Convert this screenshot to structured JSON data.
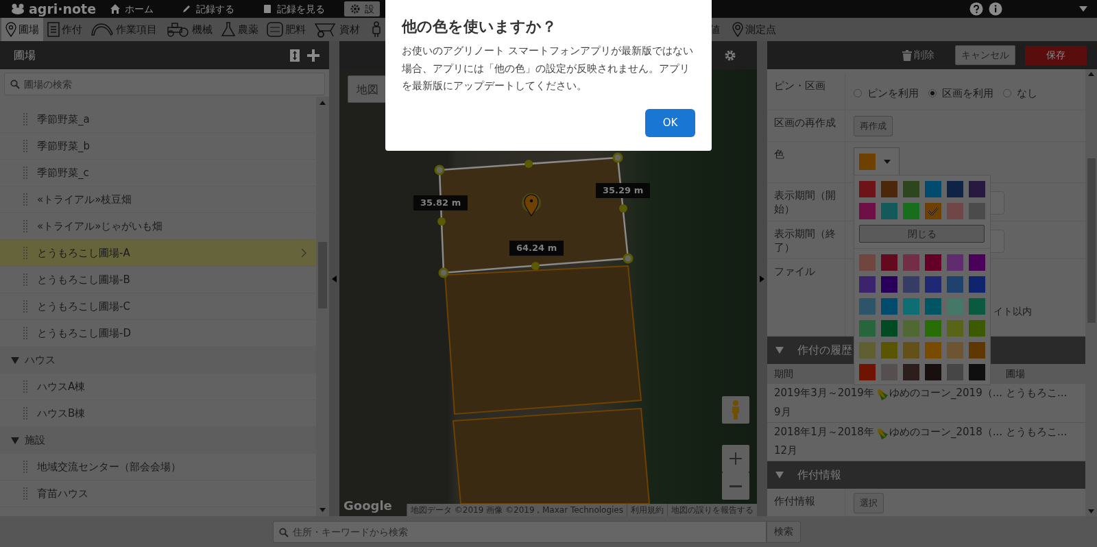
{
  "top_nav": {
    "logo": "agri·note",
    "items": [
      {
        "label": "ホーム",
        "selected": false
      },
      {
        "label": "記録する",
        "selected": false
      },
      {
        "label": "記録を見る",
        "selected": false
      },
      {
        "label": "設",
        "selected": true
      }
    ]
  },
  "toolbar": [
    {
      "label": "圃場",
      "selected": true
    },
    {
      "label": "作付",
      "selected": false
    },
    {
      "label": "作業項目",
      "selected": false
    },
    {
      "label": "機械",
      "selected": false
    },
    {
      "label": "農薬",
      "selected": false
    },
    {
      "label": "肥料",
      "selected": false
    },
    {
      "label": "資材",
      "selected": false
    },
    {
      "selected": false
    },
    {
      "label": "値",
      "selected": false
    },
    {
      "label": "測定点",
      "selected": false
    }
  ],
  "field_panel": {
    "title": "圃場",
    "search": {
      "placeholder": "圃場の検索"
    },
    "items": [
      {
        "kind": "field",
        "label": "季節野菜_a",
        "selected": false
      },
      {
        "kind": "field",
        "label": "季節野菜_b",
        "selected": false
      },
      {
        "kind": "field",
        "label": "季節野菜_c",
        "selected": false
      },
      {
        "kind": "field",
        "label": "«トライアル»枝豆畑",
        "selected": false
      },
      {
        "kind": "field",
        "label": "«トライアル»じゃがいも畑",
        "selected": false
      },
      {
        "kind": "field",
        "label": "とうもろこし圃場-A",
        "selected": true
      },
      {
        "kind": "field",
        "label": "とうもろこし圃場-B",
        "selected": false
      },
      {
        "kind": "field",
        "label": "とうもろこし圃場-C",
        "selected": false
      },
      {
        "kind": "field",
        "label": "とうもろこし圃場-D",
        "selected": false
      },
      {
        "kind": "group",
        "label": "ハウス",
        "expanded": true,
        "children": [
          {
            "kind": "field",
            "label": "ハウスA棟",
            "selected": false
          },
          {
            "kind": "field",
            "label": "ハウスB棟",
            "selected": false
          }
        ]
      },
      {
        "kind": "group",
        "label": "施設",
        "expanded": true,
        "children": [
          {
            "kind": "field",
            "label": "地域交流センター（部会会場）",
            "selected": false
          },
          {
            "kind": "field",
            "label": "育苗ハウス",
            "selected": false
          }
        ]
      }
    ]
  },
  "map": {
    "map_type_button": "地図",
    "distance_labels": [
      "35.82 m",
      "35.29 m",
      "64.24 m"
    ],
    "logo": "Google",
    "attribution": [
      "地図データ ©2019 画像 ©2019 , Maxar Technologies",
      "利用規約",
      "地図の誤りを報告する"
    ]
  },
  "address_search": {
    "placeholder": "住所・キーワードから検索",
    "button": "検索"
  },
  "detail_panel": {
    "actions": {
      "delete": "削除",
      "cancel": "キャンセル",
      "save": "保存"
    },
    "pin_area": {
      "label": "ピン・区画",
      "options": [
        {
          "label": "ピンを利用",
          "selected": false
        },
        {
          "label": "区画を利用",
          "selected": true
        },
        {
          "label": "なし",
          "selected": false
        }
      ]
    },
    "recreate": {
      "label": "区画の再作成",
      "button": "再作成"
    },
    "color": {
      "label": "色",
      "color": "#6e4100"
    },
    "display_start": {
      "label": "表示期間（開始）"
    },
    "display_end": {
      "label": "表示期間（終了）"
    },
    "file": {
      "label": "ファイル",
      "note": "イト以内"
    },
    "history": {
      "title": "作付の履歴",
      "expanded": true,
      "column_1": "期間",
      "column_3": "圃場",
      "rows": [
        {
          "period": "2019年3月～2019年9月",
          "crop": "ゆめのコーン_2019（...",
          "field": "とうもろこ..."
        },
        {
          "period": "2018年1月～2018年12月",
          "crop": "ゆめのコーン_2018（...",
          "field": "とうもろこ..."
        }
      ]
    },
    "crop_info": {
      "title": "作付情報",
      "expanded": true,
      "label": "作付情報",
      "button": "選択"
    }
  },
  "color_picker": {
    "basic": [
      {
        "color": "#6e1419",
        "selected": false
      },
      {
        "color": "#4b280a",
        "selected": false
      },
      {
        "color": "#2d461e",
        "selected": false
      },
      {
        "color": "#004b6e",
        "selected": false
      },
      {
        "color": "#0f2346",
        "selected": false
      },
      {
        "color": "#281941",
        "selected": false
      },
      {
        "color": "#6e0f46",
        "selected": false
      },
      {
        "color": "#145a5a",
        "selected": false
      },
      {
        "color": "#196e1e",
        "selected": false
      },
      {
        "color": "#6e4100",
        "selected": true
      },
      {
        "color": "#704646",
        "selected": false
      },
      {
        "color": "#4b4b4b",
        "selected": false
      }
    ],
    "close_button": "閉じる",
    "other": [
      {
        "color": "#70463f",
        "selected": false
      },
      {
        "color": "#640a1e",
        "selected": false
      },
      {
        "color": "#732d46",
        "selected": false
      },
      {
        "color": "#640028",
        "selected": false
      },
      {
        "color": "#5f2d6e",
        "selected": false
      },
      {
        "color": "#4b005a",
        "selected": false
      },
      {
        "color": "#3c236e",
        "selected": false
      },
      {
        "color": "#28005a",
        "selected": false
      },
      {
        "color": "#373c64",
        "selected": false
      },
      {
        "color": "#1e2873",
        "selected": false
      },
      {
        "color": "#1e416e",
        "selected": false
      },
      {
        "color": "#0f236e",
        "selected": false
      },
      {
        "color": "#2d5569",
        "selected": false
      },
      {
        "color": "#004b6e",
        "selected": false
      },
      {
        "color": "#0f6e73",
        "selected": false
      },
      {
        "color": "#005564",
        "selected": false
      },
      {
        "color": "#467869",
        "selected": false
      },
      {
        "color": "#0a5a41",
        "selected": false
      },
      {
        "color": "#28643c",
        "selected": false
      },
      {
        "color": "#004b23",
        "selected": false
      },
      {
        "color": "#506932",
        "selected": false
      },
      {
        "color": "#286e05",
        "selected": false
      },
      {
        "color": "#5a6419",
        "selected": false
      },
      {
        "color": "#3c5a00",
        "selected": false
      },
      {
        "color": "#5f5f32",
        "selected": false
      },
      {
        "color": "#5a5500",
        "selected": false
      },
      {
        "color": "#645019",
        "selected": false
      },
      {
        "color": "#784b00",
        "selected": false
      },
      {
        "color": "#6e5532",
        "selected": false
      },
      {
        "color": "#5f3700",
        "selected": false
      },
      {
        "color": "#6e1400",
        "selected": false
      },
      {
        "color": "#55504f",
        "selected": false
      },
      {
        "color": "#2d1e1e",
        "selected": false
      },
      {
        "color": "#190f0f",
        "selected": false
      },
      {
        "color": "#464646",
        "selected": false
      },
      {
        "color": "#0f0f0f",
        "selected": false
      }
    ]
  },
  "dialog": {
    "title": "他の色を使いますか？",
    "message": "お使いのアグリノート スマートフォンアプリが最新版ではない場合、アプリには「他の色」の設定が反映されません。アプリを最新版にアップデートしてください。",
    "ok_button": "OK"
  }
}
